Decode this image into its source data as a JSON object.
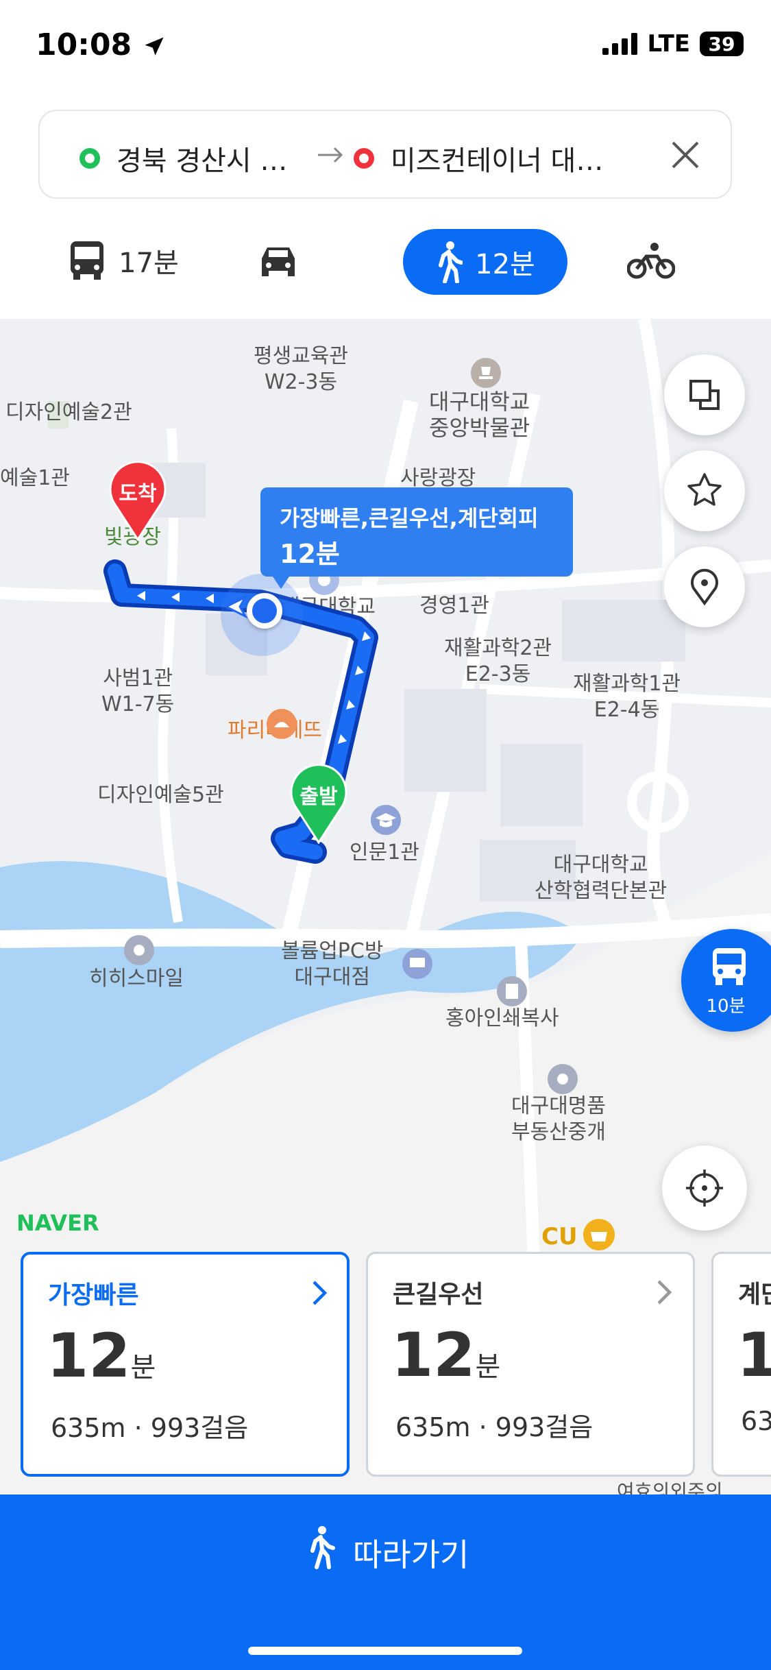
{
  "status": {
    "time": "10:08",
    "network": "LTE",
    "battery": "39"
  },
  "route": {
    "origin": "경북 경산시 …",
    "destination": "미즈컨테이너 대…"
  },
  "modes": {
    "bus_time": "17분",
    "walk_time": "12분"
  },
  "map": {
    "labels": {
      "pyeongsaeng": "평생교육관\nW2-3동",
      "design_art2": "디자인예술2관",
      "museum": "대구대학교\n중앙박물관",
      "art1": "예술1관",
      "sarang": "사랑광장",
      "bitnarae": "빛광장",
      "university": "대구대학교",
      "gyeongyeong": "경영1관",
      "rehab2": "재활과학2관\nE2-3동",
      "rehab1": "재활과학1관\nE2-4동",
      "sabeom": "사범1관\nW1-7동",
      "paris": "파리바게뜨",
      "design_art5": "디자인예술5관",
      "inmun": "인문1관",
      "industry": "대구대학교\n산학협력단본관",
      "hihi": "히히스마일",
      "pcbang": "볼륨업PC방\n대구대점",
      "hongah": "홍아인쇄복사",
      "realty": "대구대명품\n부동산중개",
      "cu": "CU",
      "naver": "NAVER",
      "partial_bottom": "여효의외주의"
    },
    "arrive_pin": "도착",
    "depart_pin": "출발",
    "tooltip_line1": "가장빠른,큰길우선,계단회피",
    "tooltip_line2": "12분",
    "bus_fab_time": "10분",
    "colors": {
      "route": "#0a4ee0",
      "accent": "#0a6cf5",
      "arrive": "#f0323c",
      "depart": "#1fbf5a"
    }
  },
  "cards": [
    {
      "title": "가장빠른",
      "time": "12",
      "unit": "분",
      "distance": "635m",
      "steps": "993걸음",
      "selected": true
    },
    {
      "title": "큰길우선",
      "time": "12",
      "unit": "분",
      "distance": "635m",
      "steps": "993걸음",
      "selected": false
    },
    {
      "title": "계단",
      "time": "1",
      "unit": "",
      "distance": "63",
      "steps": "",
      "selected": false
    }
  ],
  "follow_label": "따라가기"
}
